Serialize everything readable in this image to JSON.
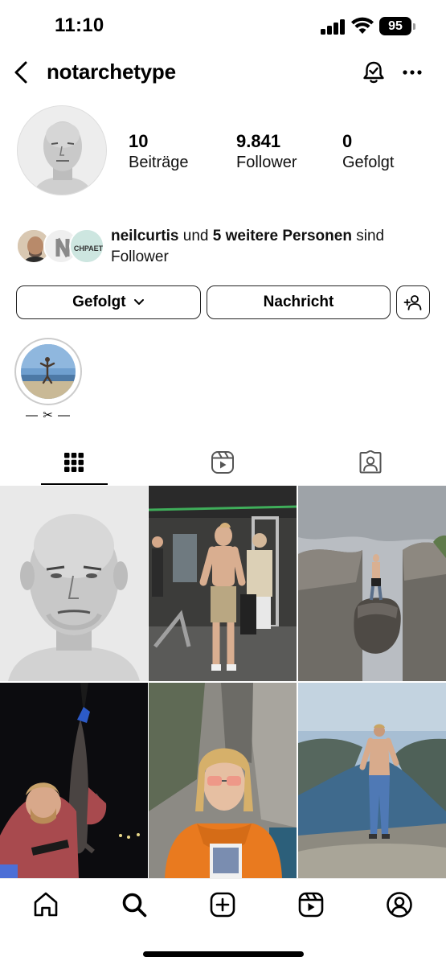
{
  "status_bar": {
    "time": "11:10",
    "battery": "95"
  },
  "header": {
    "username": "notarchetype"
  },
  "stats": [
    {
      "value": "10",
      "label": "Beiträge"
    },
    {
      "value": "9.841",
      "label": "Follower"
    },
    {
      "value": "0",
      "label": "Gefolgt"
    }
  ],
  "followed_by": {
    "name": "neilcurtis",
    "connector": "und",
    "others": "5 weitere Personen",
    "suffix": "sind Follower",
    "badge_text": "CHPAET"
  },
  "actions": {
    "follow_label": "Gefolgt",
    "message_label": "Nachricht"
  },
  "highlight": {
    "label": "— ✂ —"
  },
  "tabs": [
    "grid-icon",
    "reels-icon",
    "tagged-icon"
  ],
  "nav": [
    "home-icon",
    "search-icon",
    "create-icon",
    "reels-icon",
    "profile-icon"
  ],
  "colors": {
    "text": "#000000",
    "border": "#222222",
    "divider": "#dbdbdb"
  }
}
